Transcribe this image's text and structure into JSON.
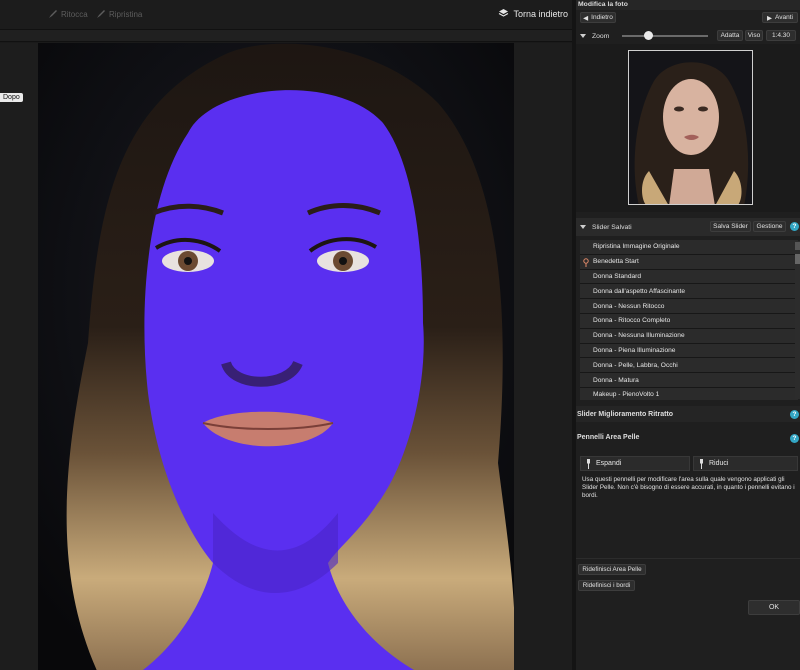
{
  "toolbar": {
    "retouch_label": "Ritocca",
    "restore_label": "Ripristina",
    "back_label": "Torna indietro"
  },
  "canvas": {
    "view_label": "Dopo"
  },
  "panel": {
    "title": "Modifica la foto",
    "back_button": "Indietro",
    "forward_button": "Avanti",
    "zoom_label": "Zoom",
    "zoom_level": 0.3,
    "fit_button": "Adatta",
    "face_button": "Viso",
    "ratio_button": "1:4.30"
  },
  "saved_sliders": {
    "title": "Slider Salvati",
    "save_button": "Salva Slider",
    "manage_button": "Gestione",
    "presets": [
      {
        "label": "Ripristina Immagine Originale",
        "pinned": false
      },
      {
        "label": "Benedetta Start",
        "pinned": true
      },
      {
        "label": "Donna Standard",
        "pinned": false
      },
      {
        "label": "Donna dall'aspetto Affascinante",
        "pinned": false
      },
      {
        "label": "Donna - Nessun Ritocco",
        "pinned": false
      },
      {
        "label": "Donna -  Ritocco Completo",
        "pinned": false
      },
      {
        "label": "Donna - Nessuna Illuminazione",
        "pinned": false
      },
      {
        "label": "Donna - Piena Illuminazione",
        "pinned": false
      },
      {
        "label": "Donna - Pelle, Labbra, Occhi",
        "pinned": false
      },
      {
        "label": "Donna - Matura",
        "pinned": false
      },
      {
        "label": "Makeup - PienoVolto 1",
        "pinned": false
      }
    ]
  },
  "portrait_sliders": {
    "title": "Slider Miglioramento Ritratto"
  },
  "skin_brushes": {
    "title": "Pennelli Area Pelle",
    "expand_button": "Espandi",
    "reduce_button": "Riduci",
    "description": "Usa questi pennelli per modificare l'area sulla quale vengono applicati gli Slider Pelle. Non c'è bisogno di essere accurati, in quanto i pennelli evitano i bordi.",
    "redefine_skin_button": "Ridefinisci Area Pelle",
    "redefine_edges_button": "Ridefinisci i bordi",
    "ok_button": "OK"
  },
  "colors": {
    "skin_mask": "#5a2ff0",
    "help_accent": "#33a6c4",
    "panel_bg": "#1f1f1f"
  }
}
